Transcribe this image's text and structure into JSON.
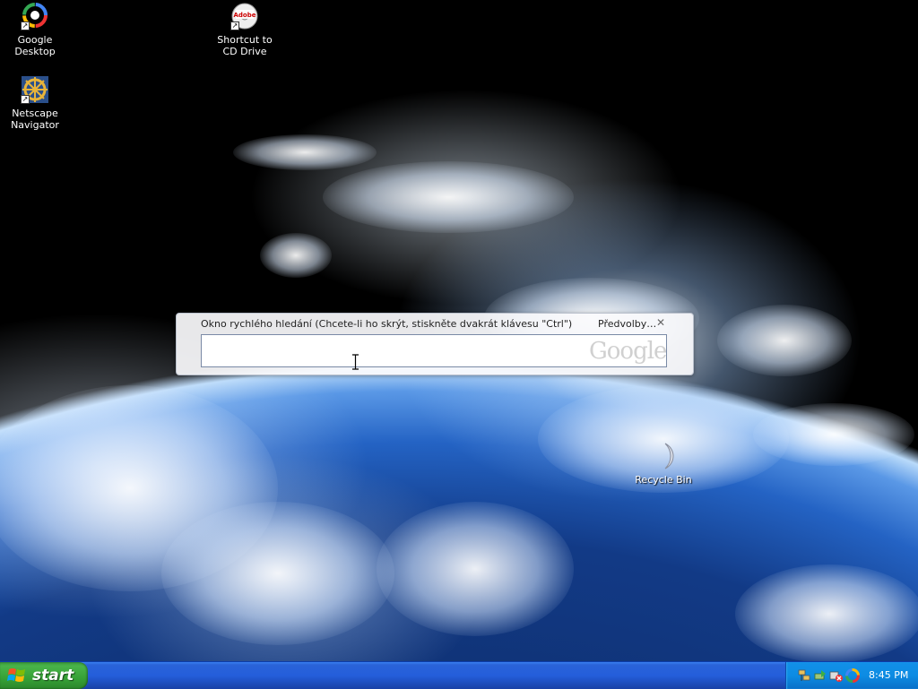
{
  "desktop": {
    "icons": [
      {
        "label": "Google Desktop",
        "icon": "google-desktop-icon"
      },
      {
        "label": "Shortcut to CD Drive",
        "icon": "adobe-cd-icon"
      },
      {
        "label": "Netscape Navigator",
        "icon": "netscape-icon"
      },
      {
        "label": "Recycle Bin",
        "icon": "recycle-bin-icon"
      }
    ]
  },
  "quick_search": {
    "hint": "Okno rychlého hledání (Chcete-li ho skrýt, stiskněte dvakrát klávesu \"Ctrl\")",
    "preferences_label": "Předvolby…",
    "close_glyph": "✕",
    "input_value": "",
    "logo_text": "Google"
  },
  "taskbar": {
    "start_label": "start",
    "clock": "8:45 PM",
    "tray_icons": [
      "network-icon",
      "safely-remove-icon",
      "audio-icon",
      "google-desktop-tray-icon"
    ]
  },
  "colors": {
    "start_green": "#36a136",
    "taskbar_blue": "#245edb",
    "tray_blue": "#0d8ce3"
  }
}
